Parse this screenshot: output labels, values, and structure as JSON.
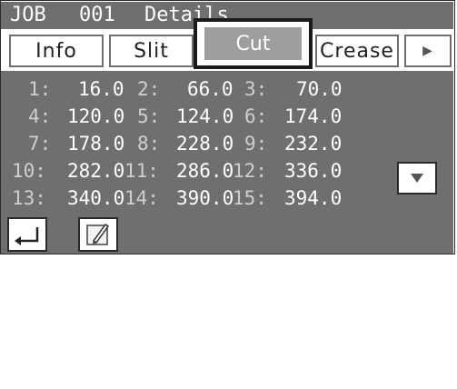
{
  "title": {
    "job_label": "JOB",
    "job_number": "001",
    "section": "Details"
  },
  "tabs": [
    {
      "label": "Info"
    },
    {
      "label": "Slit"
    },
    {
      "label": "Cut",
      "selected": true
    },
    {
      "label": "Crease"
    },
    {
      "label": "▶"
    }
  ],
  "positions": [
    {
      "index": "1:",
      "value": "16.0"
    },
    {
      "index": "2:",
      "value": "66.0"
    },
    {
      "index": "3:",
      "value": "70.0"
    },
    {
      "index": "4:",
      "value": "120.0"
    },
    {
      "index": "5:",
      "value": "124.0"
    },
    {
      "index": "6:",
      "value": "174.0"
    },
    {
      "index": "7:",
      "value": "178.0"
    },
    {
      "index": "8:",
      "value": "228.0"
    },
    {
      "index": "9:",
      "value": "232.0"
    },
    {
      "index": "10:",
      "value": "282.0"
    },
    {
      "index": "11:",
      "value": "286.0"
    },
    {
      "index": "12:",
      "value": "336.0"
    },
    {
      "index": "13:",
      "value": "340.0"
    },
    {
      "index": "14:",
      "value": "390.0"
    },
    {
      "index": "15:",
      "value": "394.0"
    }
  ],
  "scroll": {
    "icon": "triangle-down-icon"
  },
  "footer": {
    "back_icon": "return-arrow-icon",
    "edit_icon": "pencil-edit-icon"
  },
  "colors": {
    "panel": "#6f6f6f",
    "selected_tab": "#9e9e9e",
    "index_text": "#cfcfcf"
  }
}
